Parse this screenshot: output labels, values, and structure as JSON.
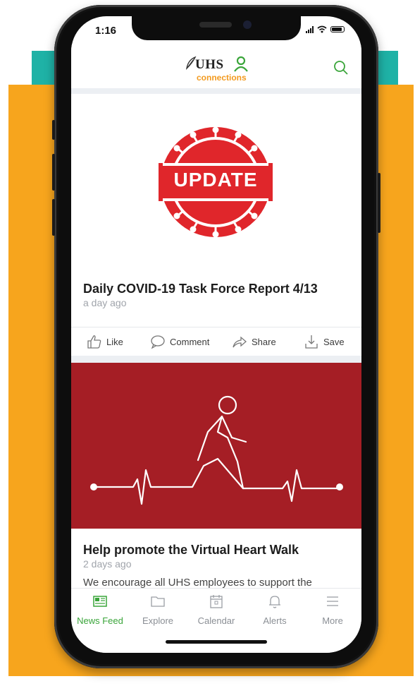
{
  "status_bar": {
    "time": "1:16"
  },
  "header": {
    "logo_text": "UHS",
    "logo_subtext": "connections",
    "search_icon": "search-icon"
  },
  "posts": [
    {
      "image_label": "UPDATE",
      "title": "Daily COVID-19 Task Force Report 4/13",
      "time": "a day ago",
      "actions": [
        {
          "label": "Like",
          "icon": "thumbs-up-icon"
        },
        {
          "label": "Comment",
          "icon": "comment-icon"
        },
        {
          "label": "Share",
          "icon": "share-icon"
        },
        {
          "label": "Save",
          "icon": "save-icon"
        }
      ]
    },
    {
      "title": "Help promote the Virtual Heart Walk",
      "time": "2 days ago",
      "snippet": "We encourage all UHS employees to support the"
    }
  ],
  "tabs": [
    {
      "label": "News Feed",
      "icon": "newspaper-icon",
      "active": true
    },
    {
      "label": "Explore",
      "icon": "folder-icon",
      "active": false
    },
    {
      "label": "Calendar",
      "icon": "calendar-icon",
      "active": false
    },
    {
      "label": "Alerts",
      "icon": "bell-icon",
      "active": false
    },
    {
      "label": "More",
      "icon": "menu-icon",
      "active": false
    }
  ],
  "colors": {
    "accent_green": "#3aa53a",
    "brand_orange": "#f39a1e",
    "update_red": "#e0262b",
    "walk_red": "#a51e25",
    "teal": "#1fb2a6",
    "orange_bg": "#f7a51d"
  }
}
